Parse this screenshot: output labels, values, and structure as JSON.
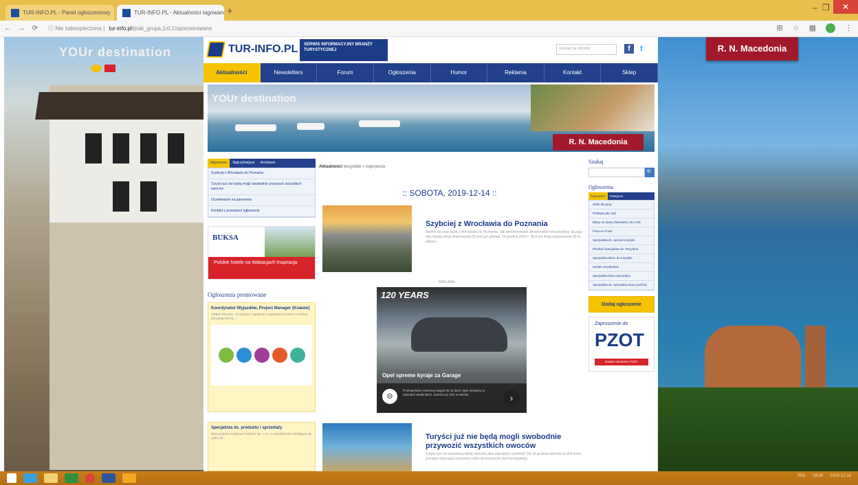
{
  "browser": {
    "tabs": [
      {
        "title": "TUR-INFO.PL - Panel ogłoszeniowy",
        "active": false
      },
      {
        "title": "TUR-INFO.PL - Aktualności tagowane",
        "active": true
      }
    ],
    "new_tab_label": "+",
    "address": {
      "security_label": "Nie zabezpieczona",
      "domain": "tur-info.pl",
      "path": "/p/ak_grupa,1/d,1/sponsorowane"
    },
    "window_controls": {
      "minimize": "–",
      "maximize": "❐",
      "close": "✕"
    },
    "nav": {
      "back": "←",
      "forward": "→",
      "reload": "⟳"
    }
  },
  "left_skin": {
    "destination_text": "YOUr destination"
  },
  "right_skin": {
    "badge": "R. N. Macedonia"
  },
  "site": {
    "logo_text": "TUR-INFO.PL",
    "tagline": "SERWIS INFORMACYJNY BRANŻY TURYSTYCZNEJ",
    "search_placeholder": "szukaj na stronie",
    "social": {
      "facebook": "f",
      "twitter": "t"
    },
    "menu": [
      "Aktualności",
      "Newsletters",
      "Forum",
      "Ogłoszenia",
      "Humor",
      "Reklama",
      "Kontakt",
      "Sklep"
    ],
    "banner": {
      "destination": "YOUr destination",
      "badge": "R. N. Macedonia"
    }
  },
  "left_column": {
    "tabs": [
      "Najnowsze",
      "Najczytniejsze",
      "Archiwum"
    ],
    "items": [
      "Szybciej z Wrocławia do Poznania",
      "Turyści już nie będą mogli swobodnie przywozić wszystkich owoców",
      "Oczekiwanie na panorama",
      "Kontakt z przepisem ogłoszenie"
    ],
    "buksa": {
      "logo": "BUKSA",
      "text": "Polskie hotele na Wakacjach Inspiracja"
    },
    "promo_title": "Ogłoszenia promowane",
    "jobs": [
      {
        "title": "Koordynator Wyjazdów, Project Manager (Kraków)",
        "text": "ORBIS TRAVEL - to wiodący organizator wyjazdów incentive w Polsce. Od ponad 25 lat..."
      },
      {
        "title": "Specjalista ds. produktu i sprzedaży",
        "text": "Biuro podróży Kolejowe Podróże Sp. z o.o. z powodzeniem działające na rynku od..."
      }
    ]
  },
  "center": {
    "breadcrumb_bold": "Aktualności",
    "breadcrumb_rest": "wszystkie » najnowsze",
    "date": ":: SOBOTA, 2019-12-14 ::",
    "article1": {
      "title": "Szybciej z Wrocławia do Poznania",
      "text": "Skrócił się czas jazdy z Wrocławia do Poznania. Jak poinformowało Ministerstwo Infrastruktury, łączący oba miasta drogi ekspresowej S5 jest już gotowa. 14 grudnia 2019 r. 36,5 km drogi ekspresowej S5 m... więcej »"
    },
    "ad_label": "REKLAMA",
    "ad": {
      "headline": "120 YEARS",
      "tagline": "Opel spreme kyraje za Garage",
      "small": "Profesjonalny rowerowy bagażnik na dach Opel dostępny w salonach dealerskich. Zamów już dziś w salonie.",
      "brand": "⊖",
      "arrow": "›"
    },
    "article2": {
      "title": "Turyści już nie będą mogli swobodnie przywozić wszystkich owoców",
      "text": "Turyści już nie przywiozą takiej owoców, jaka pamiętali z podróży! Od 14 grudnia owoców w Unii nowe przepisy dotyczące przywozu roślin na terytorium Unii Europejskiej."
    }
  },
  "right_column": {
    "search_title": "Szukaj",
    "search_btn": "🔍",
    "ads_title": "Ogłoszenia",
    "tabs": [
      "Najnowsze",
      "Kategorie"
    ],
    "items": [
      "szkło dla grup",
      "Praktyki jako stał",
      "Bilety na duety Żabiedeno 2D 2.5D",
      "Praca w Trovit",
      "Specjalista ds. sprzed turystyki",
      "Pilot/ka/ Specjalista ds. Rezydent",
      "Specjalista Biuro do turystyki",
      "Zostań rezydentem",
      "Specjalista biuro sprzedaży",
      "Specjalista ds. sprzedaży biuro podróży"
    ],
    "add_button": "Dodaj ogłoszenie",
    "pzot": {
      "invite": "Zaproszenie do",
      "logo": "PZOT",
      "link": "Zostań członkiem PZOT"
    }
  },
  "taskbar": {
    "time": "19:00",
    "date": "2019-12-14",
    "lang": "POL"
  }
}
